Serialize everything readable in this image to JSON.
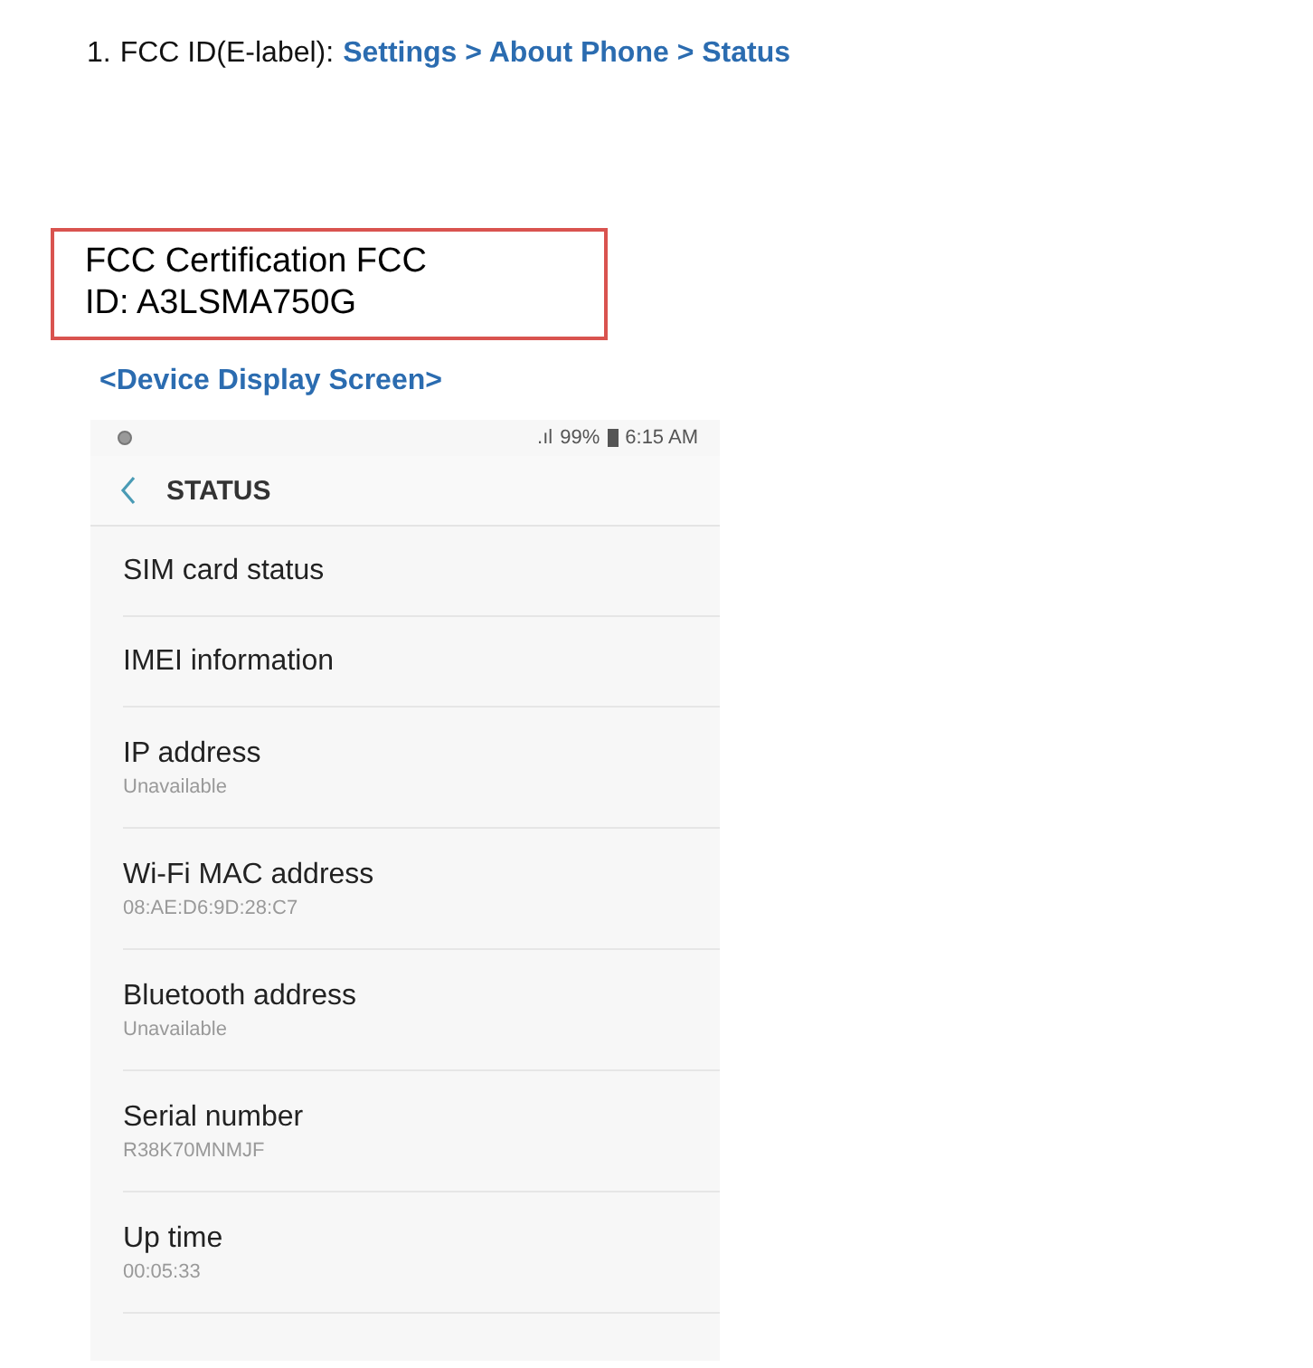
{
  "instruction": {
    "number": "1.",
    "label": "FCC ID(E-label):",
    "path": "Settings > About Phone > Status"
  },
  "certification_box": {
    "lines": [
      "FCC Certification FCC",
      "ID: A3LSMA750G"
    ]
  },
  "caption": "<Device Display Screen>",
  "phone": {
    "status_bar": {
      "signal": ".ıl",
      "battery": "99%",
      "time": "6:15 AM"
    },
    "title": "STATUS",
    "items": [
      {
        "title": "SIM card status"
      },
      {
        "title": "IMEI information"
      },
      {
        "title": "IP address",
        "value": "Unavailable"
      },
      {
        "title": "Wi-Fi MAC address",
        "value": "08:AE:D6:9D:28:C7"
      },
      {
        "title": "Bluetooth address",
        "value": "Unavailable"
      },
      {
        "title": "Serial number",
        "value": "R38K70MNMJF"
      },
      {
        "title": "Up time",
        "value": "00:05:33"
      }
    ]
  }
}
